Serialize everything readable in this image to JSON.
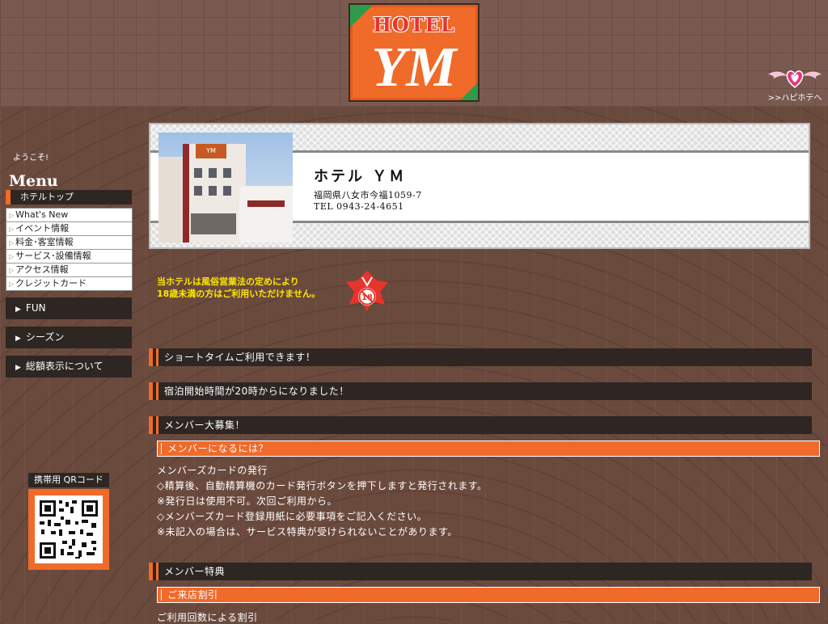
{
  "header": {
    "logo_top": "HOTEL",
    "logo_main": "YM",
    "happy_link": ">>ハピホテへ"
  },
  "sidebar": {
    "welcome": "ようこそ!",
    "menu_title": "Menu",
    "top_label": "ホテルトップ",
    "items": [
      {
        "label": "What's New"
      },
      {
        "label": "イベント情報"
      },
      {
        "label": "料金･客室情報"
      },
      {
        "label": "サービス･設備情報"
      },
      {
        "label": "アクセス情報"
      },
      {
        "label": "クレジットカード"
      }
    ],
    "buttons": [
      {
        "label": "FUN"
      },
      {
        "label": "シーズン"
      },
      {
        "label": "総額表示について"
      }
    ],
    "qr_caption": "携帯用 QRコード"
  },
  "hotel": {
    "name": "ホテル ＹＭ",
    "address": "福岡県八女市今福1059-7",
    "tel": "TEL 0943-24-4651",
    "photo_sign": "YM"
  },
  "notice": {
    "line1": "当ホテルは風俗営業法の定めにより",
    "line2": "18歳未満の方はご利用いただけません。",
    "age_badge": "18"
  },
  "sections": {
    "short_time": "ショートタイムご利用できます！",
    "stay_start": "宿泊開始時間が20時からになりました！",
    "member_recruit": "メンバー大募集！",
    "how_to_member": "メンバーになるには？",
    "member_lines": [
      "メンバーズカードの発行",
      "◇精算後、自動精算機のカード発行ボタンを押下しますと発行されます。",
      "※発行日は使用不可。次回ご利用から。",
      "◇メンバーズカード登録用紙に必要事項をご記入ください。",
      "※未記入の場合は、サービス特典が受けられないことがあります。"
    ],
    "member_benefit": "メンバー特典",
    "visit_discount": "ご来店割引",
    "visit_discount_desc": "ご利用回数による割引"
  },
  "colors": {
    "accent": "#f06a2a",
    "dark_bar": "#2d2623",
    "notice_yellow": "#ffe600"
  }
}
